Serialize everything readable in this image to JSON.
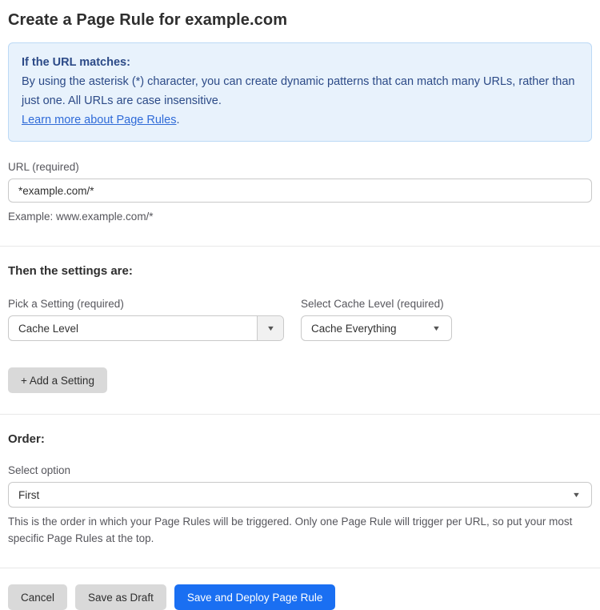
{
  "page": {
    "title": "Create a Page Rule for example.com"
  },
  "info_box": {
    "heading": "If the URL matches:",
    "body": "By using the asterisk (*) character, you can create dynamic patterns that can match many URLs, rather than just one. All URLs are case insensitive.",
    "link": "Learn more about Page Rules",
    "link_suffix": "."
  },
  "url_field": {
    "label": "URL (required)",
    "value": "*example.com/*",
    "helper": "Example: www.example.com/*"
  },
  "settings": {
    "heading": "Then the settings are:",
    "setting_label": "Pick a Setting (required)",
    "setting_value": "Cache Level",
    "cache_label": "Select Cache Level (required)",
    "cache_value": "Cache Everything",
    "add_button_label": "+ Add a Setting"
  },
  "order": {
    "heading": "Order:",
    "label": "Select option",
    "value": "First",
    "helper": "This is the order in which your Page Rules will be triggered. Only one Page Rule will trigger per URL, so put your most specific Page Rules at the top."
  },
  "actions": {
    "cancel_label": "Cancel",
    "save_draft_label": "Save as Draft",
    "save_deploy_label": "Save and Deploy Page Rule"
  },
  "icons": {
    "dropdown_arrow": "▼"
  },
  "colors": {
    "accent_blue": "#1a6ff2",
    "button_gray": "#d9d9d9",
    "info_background": "#e8f2fc",
    "info_border": "#bcd9f5",
    "info_text": "#2c4a87",
    "link_blue": "#2f6bd8"
  }
}
